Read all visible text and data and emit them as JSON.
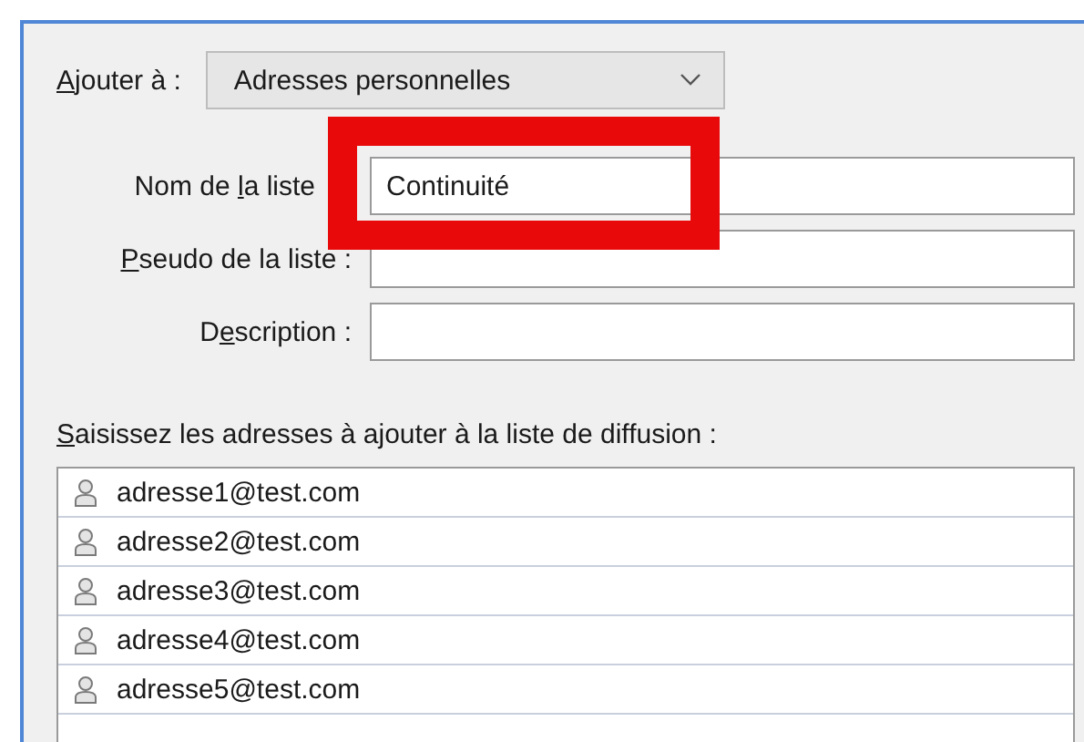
{
  "add_to": {
    "label": {
      "key": "A",
      "after": "jouter à :"
    },
    "value": "Adresses personnelles"
  },
  "fields": [
    {
      "label": {
        "before": "Nom de ",
        "key": "l",
        "after": "a liste"
      },
      "value": "Continuité",
      "highlighted": true
    },
    {
      "label": {
        "key": "P",
        "after": "seudo de la liste :"
      },
      "highlighted": false
    },
    {
      "label": {
        "before": "D",
        "key": "e",
        "after": "scription :"
      },
      "highlighted": false
    }
  ],
  "addresses_label": {
    "key": "S",
    "after": "aisissez les adresses à ajouter à la liste de diffusion :"
  },
  "addresses": [
    "adresse1@test.com",
    "adresse2@test.com",
    "adresse3@test.com",
    "adresse4@test.com",
    "adresse5@test.com"
  ]
}
